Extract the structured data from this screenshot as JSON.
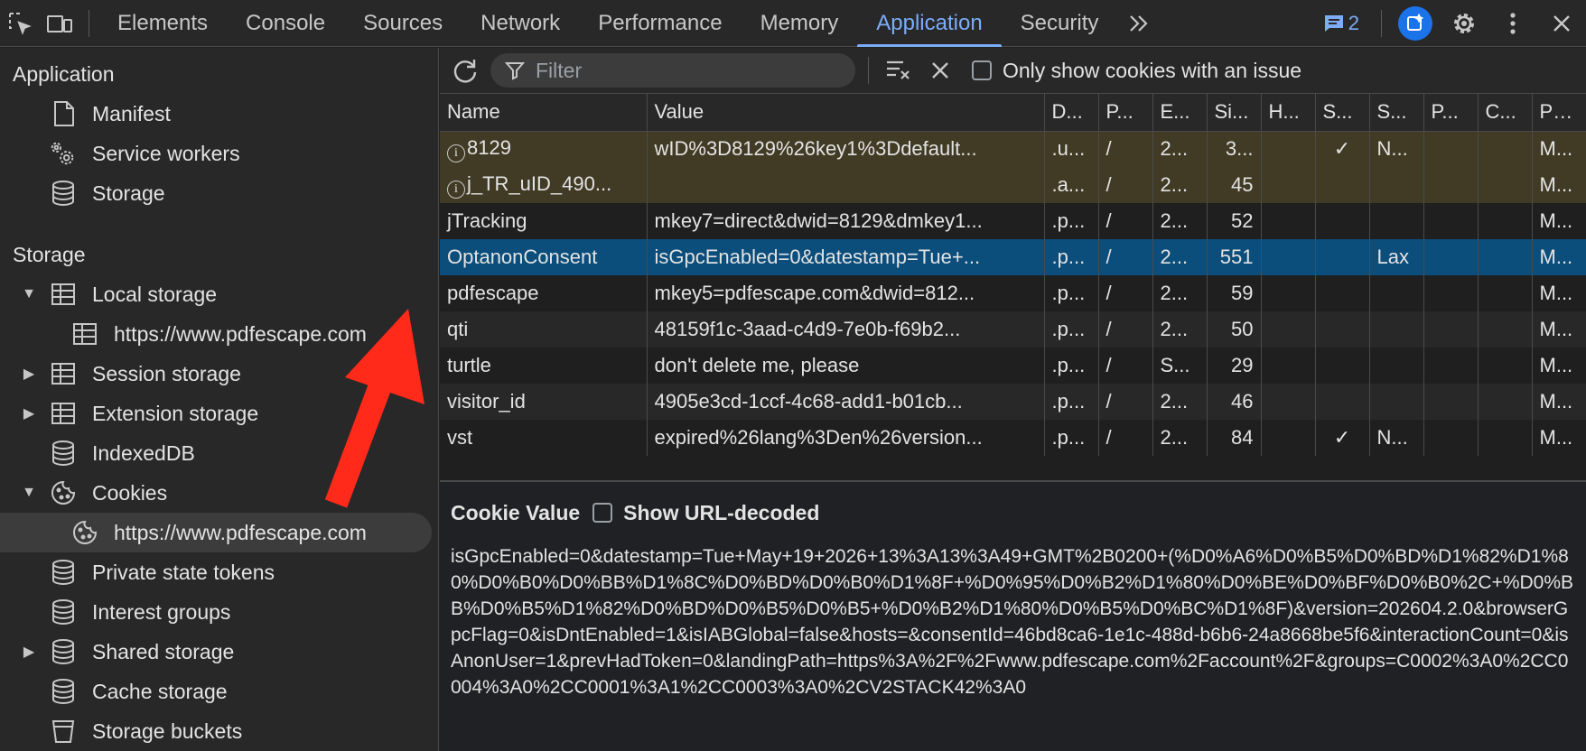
{
  "toolbar": {
    "tabs": [
      {
        "label": "Elements"
      },
      {
        "label": "Console"
      },
      {
        "label": "Sources"
      },
      {
        "label": "Network"
      },
      {
        "label": "Performance"
      },
      {
        "label": "Memory"
      },
      {
        "label": "Application",
        "active": true
      },
      {
        "label": "Security"
      }
    ],
    "more_tabs_icon": "chevron-double-right-icon",
    "issues_count": "2",
    "accent_color": "#7cacf8"
  },
  "sidebar": {
    "application_heading": "Application",
    "application_items": [
      {
        "label": "Manifest",
        "icon": "document-icon"
      },
      {
        "label": "Service workers",
        "icon": "gears-icon"
      },
      {
        "label": "Storage",
        "icon": "database-icon"
      }
    ],
    "storage_heading": "Storage",
    "storage_items": [
      {
        "label": "Local storage",
        "icon": "table-icon"
      },
      {
        "label": "https://www.pdfescape.com",
        "icon": "table-icon"
      },
      {
        "label": "Session storage",
        "icon": "table-icon"
      },
      {
        "label": "Extension storage",
        "icon": "table-icon"
      },
      {
        "label": "IndexedDB",
        "icon": "database-icon"
      },
      {
        "label": "Cookies",
        "icon": "cookie-icon"
      },
      {
        "label": "https://www.pdfescape.com",
        "icon": "cookie-icon"
      },
      {
        "label": "Private state tokens",
        "icon": "database-icon"
      },
      {
        "label": "Interest groups",
        "icon": "database-icon"
      },
      {
        "label": "Shared storage",
        "icon": "database-icon"
      },
      {
        "label": "Cache storage",
        "icon": "database-icon"
      },
      {
        "label": "Storage buckets",
        "icon": "bucket-icon"
      }
    ]
  },
  "cookies_toolbar": {
    "filter_placeholder": "Filter",
    "only_issues_label": "Only show cookies with an issue"
  },
  "table": {
    "headers": [
      "Name",
      "Value",
      "D...",
      "P...",
      "E...",
      "Si...",
      "H...",
      "S...",
      "S...",
      "P...",
      "C...",
      "Pri..."
    ],
    "rows": [
      {
        "name": "8129",
        "value": "wID%3D8129%26key1%3Ddefault...",
        "domain": ".u...",
        "path": "/",
        "expires": "2...",
        "size": "3...",
        "http": "",
        "secure": "✓",
        "samesite": "N...",
        "partition": "",
        "cross": "",
        "priority": "M...",
        "warn": true
      },
      {
        "name": "j_TR_uID_490...",
        "value": "",
        "domain": ".a...",
        "path": "/",
        "expires": "2...",
        "size": "45",
        "http": "",
        "secure": "",
        "samesite": "",
        "partition": "",
        "cross": "",
        "priority": "M...",
        "warn": true
      },
      {
        "name": "jTracking",
        "value": "mkey7=direct&dwid=8129&dmkey1...",
        "domain": ".p...",
        "path": "/",
        "expires": "2...",
        "size": "52",
        "http": "",
        "secure": "",
        "samesite": "",
        "partition": "",
        "cross": "",
        "priority": "M..."
      },
      {
        "name": "OptanonConsent",
        "value": "isGpcEnabled=0&datestamp=Tue+...",
        "domain": ".p...",
        "path": "/",
        "expires": "2...",
        "size": "551",
        "http": "",
        "secure": "",
        "samesite": "Lax",
        "partition": "",
        "cross": "",
        "priority": "M...",
        "selected": true
      },
      {
        "name": "pdfescape",
        "value": "mkey5=pdfescape.com&dwid=812...",
        "domain": ".p...",
        "path": "/",
        "expires": "2...",
        "size": "59",
        "http": "",
        "secure": "",
        "samesite": "",
        "partition": "",
        "cross": "",
        "priority": "M..."
      },
      {
        "name": "qti",
        "value": "48159f1c-3aad-c4d9-7e0b-f69b2...",
        "domain": ".p...",
        "path": "/",
        "expires": "2...",
        "size": "50",
        "http": "",
        "secure": "",
        "samesite": "",
        "partition": "",
        "cross": "",
        "priority": "M..."
      },
      {
        "name": "turtle",
        "value": "don't delete me, please",
        "domain": ".p...",
        "path": "/",
        "expires": "S...",
        "size": "29",
        "http": "",
        "secure": "",
        "samesite": "",
        "partition": "",
        "cross": "",
        "priority": "M..."
      },
      {
        "name": "visitor_id",
        "value": "4905e3cd-1ccf-4c68-add1-b01cb...",
        "domain": ".p...",
        "path": "/",
        "expires": "2...",
        "size": "46",
        "http": "",
        "secure": "",
        "samesite": "",
        "partition": "",
        "cross": "",
        "priority": "M..."
      },
      {
        "name": "vst",
        "value": "expired%26lang%3Den%26version...",
        "domain": ".p...",
        "path": "/",
        "expires": "2...",
        "size": "84",
        "http": "",
        "secure": "✓",
        "samesite": "N...",
        "partition": "",
        "cross": "",
        "priority": "M..."
      }
    ]
  },
  "cookie_value": {
    "heading": "Cookie Value",
    "show_decoded_label": "Show URL-decoded",
    "text": "isGpcEnabled=0&datestamp=Tue+May+19+2026+13%3A13%3A49+GMT%2B0200+(%D0%A6%D0%B5%D0%BD%D1%82%D1%80%D0%B0%D0%BB%D1%8C%D0%BD%D0%B0%D1%8F+%D0%95%D0%B2%D1%80%D0%BE%D0%BF%D0%B0%2C+%D0%BB%D0%B5%D1%82%D0%BD%D0%B5%D0%B5+%D0%B2%D1%80%D0%B5%D0%BC%D1%8F)&version=202604.2.0&browserGpcFlag=0&isDntEnabled=1&isIABGlobal=false&hosts=&consentId=46bd8ca6-1e1c-488d-b6b6-24a8668be5f6&interactionCount=0&isAnonUser=1&prevHadToken=0&landingPath=https%3A%2F%2Fwww.pdfescape.com%2Faccount%2F&groups=C0002%3A0%2CC0004%3A0%2CC0001%3A1%2CC0003%3A0%2CV2STACK42%3A0"
  },
  "annotation": {
    "color": "#ff2a1a",
    "icon": "red-arrow-icon"
  }
}
